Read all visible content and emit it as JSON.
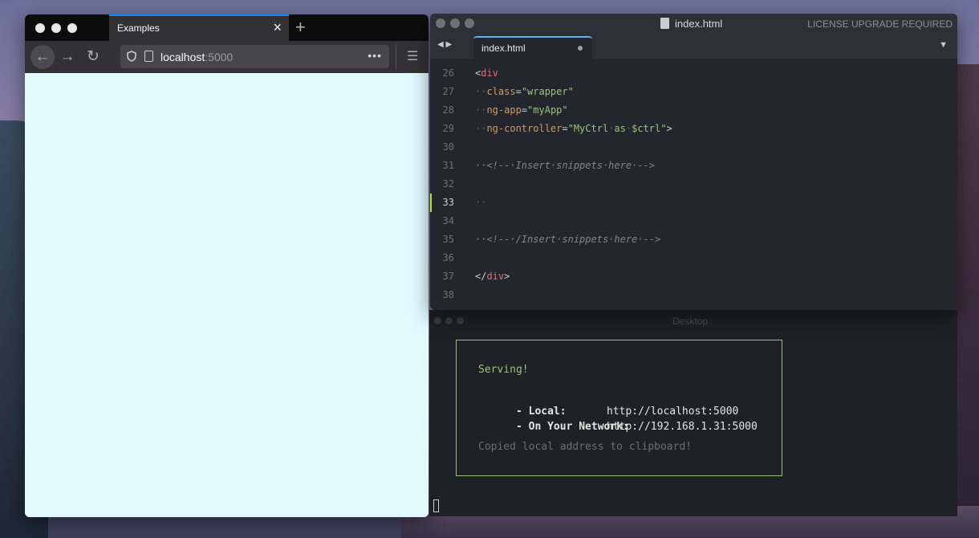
{
  "browser": {
    "tab_title": "Examples",
    "tab_close": "×",
    "new_tab": "+",
    "url_host": "localhost",
    "url_port": ":5000",
    "url_more": "•••",
    "back": "←",
    "forward": "→",
    "reload": "↻",
    "menu": "☰"
  },
  "editor": {
    "title": "index.html",
    "license": "LICENSE UPGRADE REQUIRED",
    "tab_title": "index.html",
    "nav_arrows": "◀ ▶",
    "tab_menu": "▼",
    "active_line": "33",
    "line_numbers": [
      "26",
      "27",
      "28",
      "29",
      "30",
      "31",
      "32",
      "33",
      "34",
      "35",
      "36",
      "37",
      "38"
    ]
  },
  "terminal": {
    "ghost_title": "Desktop",
    "serving": "Serving!",
    "local_label": "- Local:",
    "local_url": "http://localhost:5000",
    "network_label": "- On Your Network:",
    "network_url": "http://192.168.1.31:5000",
    "copied": "Copied local address to clipboard!"
  }
}
